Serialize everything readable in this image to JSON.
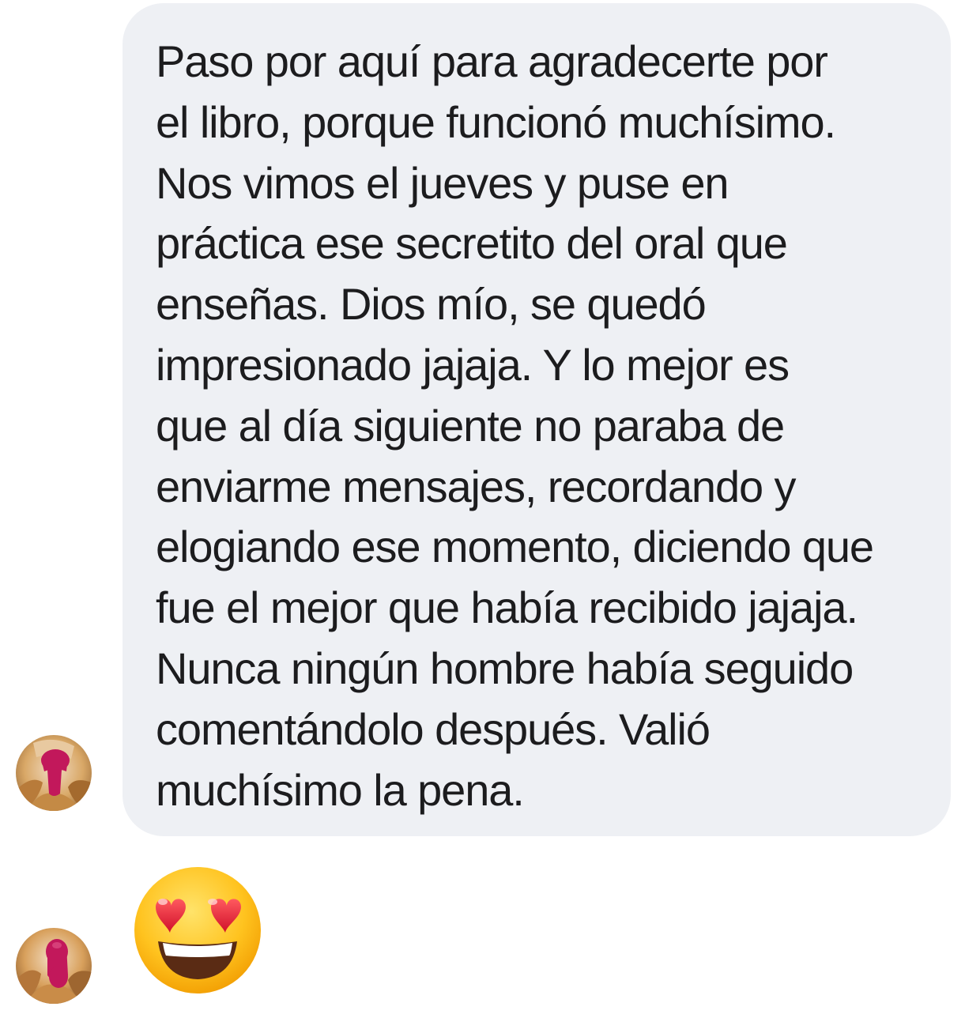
{
  "conversation": {
    "message": {
      "text": "Paso por aquí para agradecerte por\nel libro, porque funcionó muchísimo.\nNos vimos el jueves y puse en\npráctica ese secretito del oral que\nenseñas. Dios mío, se quedó\nimpresionado jajaja. Y lo mejor es\nque al día siguiente no paraba de\nenviarme mensajes, recordando y\nelogiando ese momento, diciendo que\nfue el mejor que había recibido jajaja.\nNunca ningún hombre había seguido\ncomentándolo después. Valió\nmuchísimo la pena.",
      "bubble_color": "#eef0f4",
      "text_color": "#1c1c1e"
    },
    "reaction": {
      "icon": "heart-eyes-emoji-icon"
    },
    "avatars": [
      {
        "icon": "avatar-photo-redacted"
      },
      {
        "icon": "avatar-photo-redacted"
      }
    ],
    "redaction_color": "#c2185b"
  }
}
